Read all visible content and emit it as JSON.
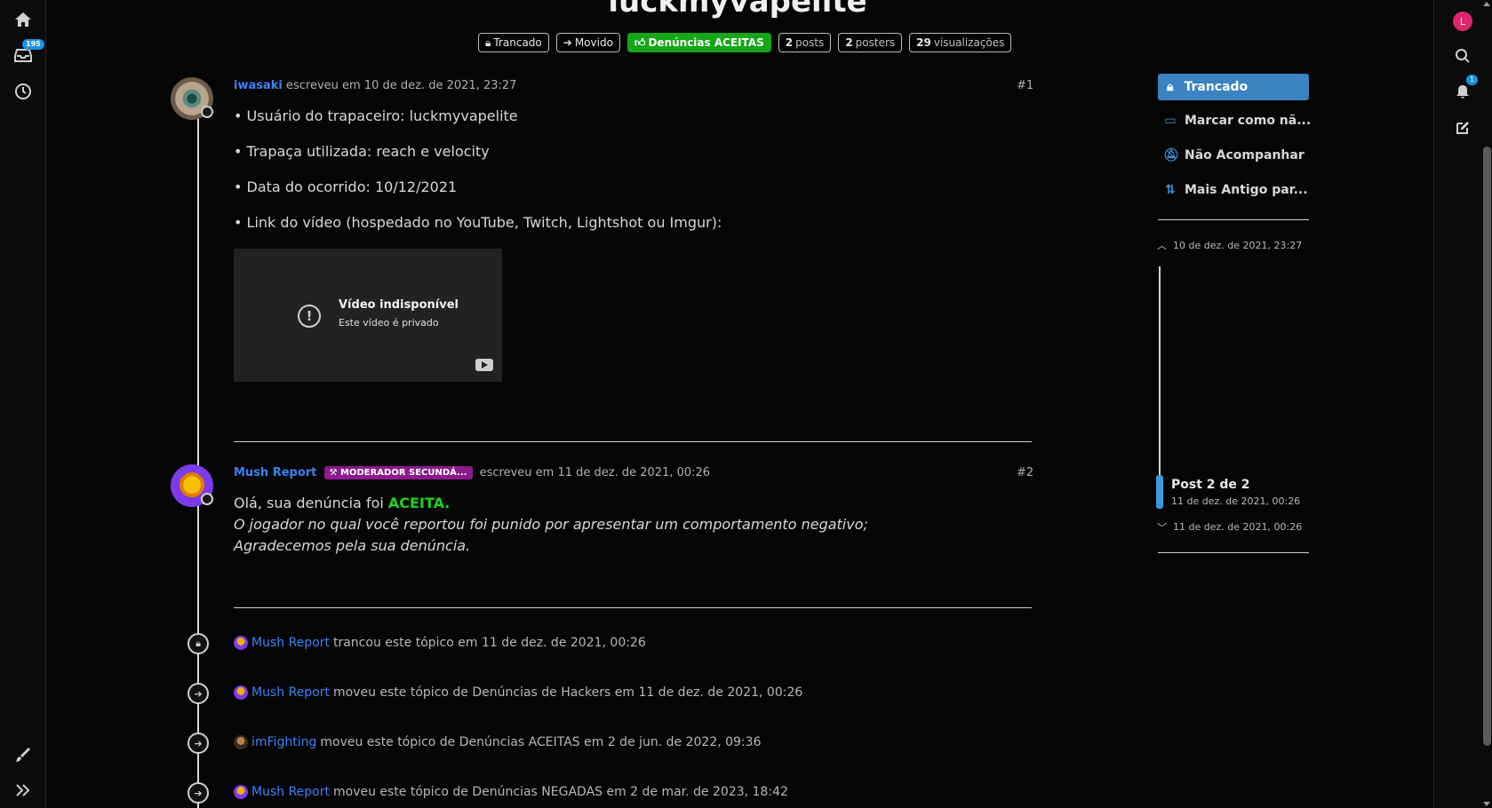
{
  "left_rail": {
    "inbox_badge": "195",
    "icons": [
      "home-icon",
      "inbox-icon",
      "history-icon",
      "brush-icon",
      "expand-icon"
    ]
  },
  "right_rail": {
    "user_initial": "L",
    "notification_badge": "1"
  },
  "topic": {
    "title": "luckmyvapelite",
    "badges": {
      "locked": "Trancado",
      "moved": "Movido",
      "category": "Denúncias ACEITAS",
      "posts_count": "2",
      "posts_label": "posts",
      "posters_count": "2",
      "posters_label": "posters",
      "views_count": "29",
      "views_label": "visualizações"
    }
  },
  "posts": [
    {
      "author": "iwasaki",
      "wrote_text": "escreveu em 10 de dez. de 2021, 23:27",
      "number": "#1",
      "lines": [
        "• Usuário do trapaceiro: luckmyvapelite",
        "• Trapaça utilizada: reach e velocity",
        "• Data do ocorrido: 10/12/2021",
        "• Link do vídeo (hospedado no YouTube, Twitch, Lightshot ou Imgur):"
      ],
      "video": {
        "title": "Vídeo indisponível",
        "subtitle": "Este vídeo é privado"
      }
    },
    {
      "author": "Mush Report",
      "role_badge": "MODERADOR SECUNDÁ...",
      "wrote_text": "escreveu em 11 de dez. de 2021, 00:26",
      "number": "#2",
      "line1_prefix": "Olá, sua denúncia foi ",
      "line1_accent": "ACEITA.",
      "line2": "O jogador no qual você reportou foi punido por apresentar um comportamento negativo;",
      "line3": "Agradecemos pela sua denúncia."
    }
  ],
  "events": [
    {
      "who": "Mush Report",
      "text": "trancou este tópico em 11 de dez. de 2021, 00:26",
      "icon": "lock-icon"
    },
    {
      "who": "Mush Report",
      "text": "moveu este tópico de Denúncias de Hackers em 11 de dez. de 2021, 00:26",
      "icon": "arrow-right-icon"
    },
    {
      "who": "imFighting",
      "text": "moveu este tópico de Denúncias ACEITAS em 2 de jun. de 2022, 09:36",
      "icon": "arrow-right-icon"
    },
    {
      "who": "Mush Report",
      "text": "moveu este tópico de Denúncias NEGADAS em 2 de mar. de 2023, 18:42",
      "icon": "arrow-right-icon"
    }
  ],
  "controls": {
    "locked": "Trancado",
    "mark_unread": "Marcar como nã...",
    "unfollow": "Não Acompanhar",
    "sort": "Mais Antigo par..."
  },
  "timeline": {
    "top_date": "10 de dez. de 2021, 23:27",
    "position_label": "Post 2 de 2",
    "position_date": "11 de dez. de 2021, 00:26",
    "bottom_date": "11 de dez. de 2021, 00:26"
  },
  "colors": {
    "accent_blue": "#3b82f6",
    "primary_button": "#3b82c0",
    "category_green": "#14a617",
    "accepted_green": "#1bd51b",
    "moderator_purple": "#8b1b8c",
    "background": "#050505"
  }
}
